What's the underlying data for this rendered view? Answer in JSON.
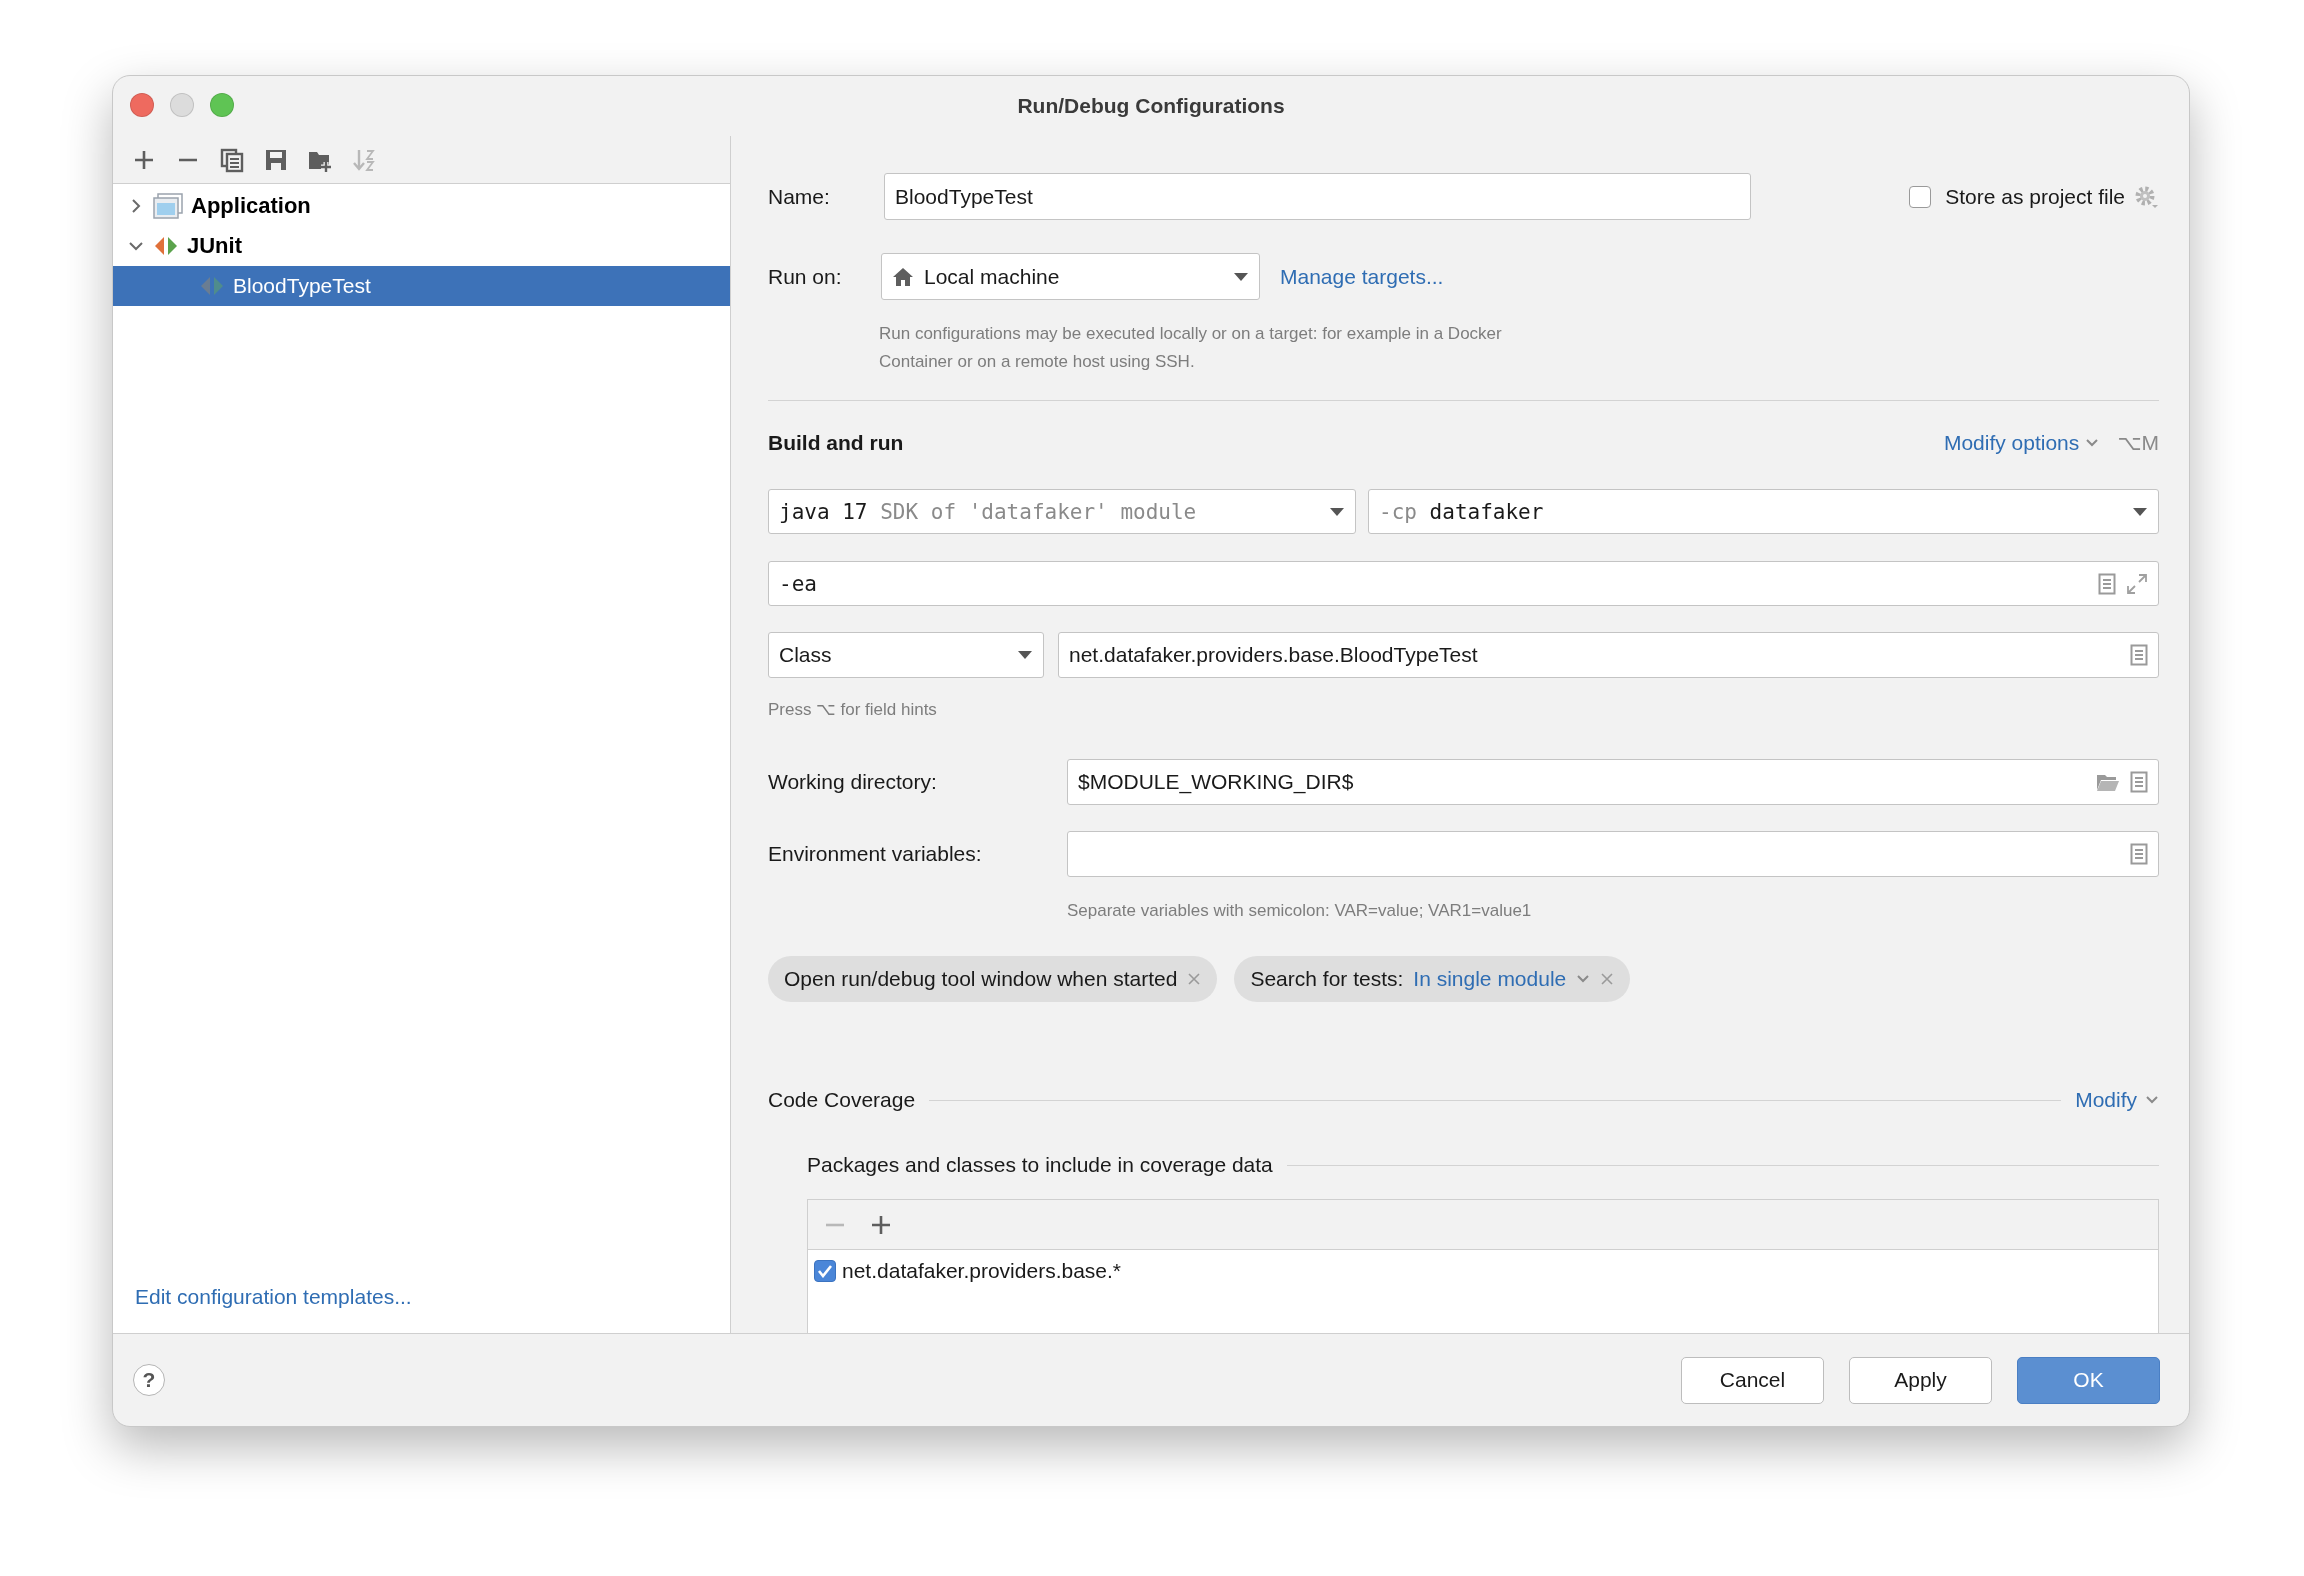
{
  "window": {
    "title": "Run/Debug Configurations"
  },
  "toolbar": [
    {
      "kind": "add",
      "disabled": false
    },
    {
      "kind": "remove",
      "disabled": false
    },
    {
      "kind": "copy",
      "disabled": false
    },
    {
      "kind": "save",
      "disabled": false
    },
    {
      "kind": "folder",
      "disabled": false
    },
    {
      "kind": "sort",
      "disabled": true
    }
  ],
  "tree": [
    {
      "label": "Application",
      "kind": "application",
      "expanded": false,
      "selected": false
    },
    {
      "label": "JUnit",
      "kind": "junit",
      "expanded": true,
      "selected": false,
      "children": [
        {
          "label": "BloodTypeTest",
          "kind": "test",
          "selected": true
        }
      ]
    }
  ],
  "templates_link": "Edit configuration templates...",
  "name": {
    "label": "Name:",
    "value": "BloodTypeTest"
  },
  "store_as_project_file": {
    "label": "Store as project file",
    "checked": false
  },
  "run_on": {
    "label": "Run on:",
    "value": "Local machine",
    "link": "Manage targets...",
    "hint": "Run configurations may be executed locally or on a target: for example in a Docker Container or on a remote host using SSH."
  },
  "build_and_run": {
    "title": "Build and run",
    "modify_link": "Modify options",
    "shortcut": "⌥M",
    "jre": {
      "value": "java 17",
      "hint": "SDK of 'datafaker' module"
    },
    "classpath": {
      "prefix": "-cp",
      "value": "datafaker"
    },
    "vm_options": "-ea",
    "test_kind": "Class",
    "test_class": "net.datafaker.providers.base.BloodTypeTest",
    "field_hint": "Press ⌥ for field hints"
  },
  "working_directory": {
    "label": "Working directory:",
    "value": "$MODULE_WORKING_DIR$"
  },
  "environment_variables": {
    "label": "Environment variables:",
    "hint": "Separate variables with semicolon: VAR=value; VAR1=value1"
  },
  "options": [
    {
      "label": "Open run/debug tool window when started"
    },
    {
      "label": "Search for tests:",
      "value": "In single module"
    }
  ],
  "code_coverage": {
    "title": "Code Coverage",
    "modify_link": "Modify",
    "packages_title": "Packages and classes to include in coverage data",
    "toolbar": [
      {
        "kind": "remove",
        "disabled": true
      },
      {
        "kind": "add",
        "disabled": false
      }
    ],
    "items": [
      {
        "label": "net.datafaker.providers.base.*",
        "checked": true
      }
    ]
  },
  "help": "?",
  "buttons": [
    {
      "label": "Cancel",
      "kind": "secondary"
    },
    {
      "label": "Apply",
      "kind": "secondary"
    },
    {
      "label": "OK",
      "kind": "default"
    }
  ]
}
